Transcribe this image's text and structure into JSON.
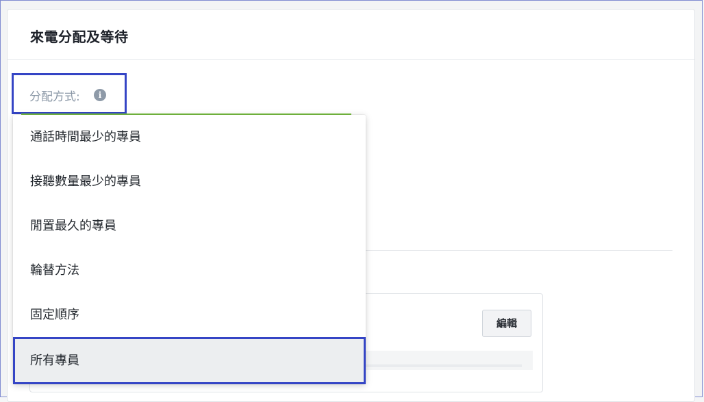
{
  "card": {
    "title": "來電分配及等待"
  },
  "field": {
    "label": "分配方式:",
    "info_icon": "info-circle-icon",
    "accent_color": "#7ac143"
  },
  "dropdown": {
    "options": [
      {
        "label": "通話時間最少的專員"
      },
      {
        "label": "接聽數量最少的專員"
      },
      {
        "label": "閒置最久的專員"
      },
      {
        "label": "輪替方法"
      },
      {
        "label": "固定順序"
      },
      {
        "label": "所有專員"
      }
    ],
    "selected_index": 5
  },
  "panel": {
    "edit_label": "編輯"
  },
  "colors": {
    "highlight_box": "#3545c5",
    "selected_bg": "#eceef0"
  }
}
